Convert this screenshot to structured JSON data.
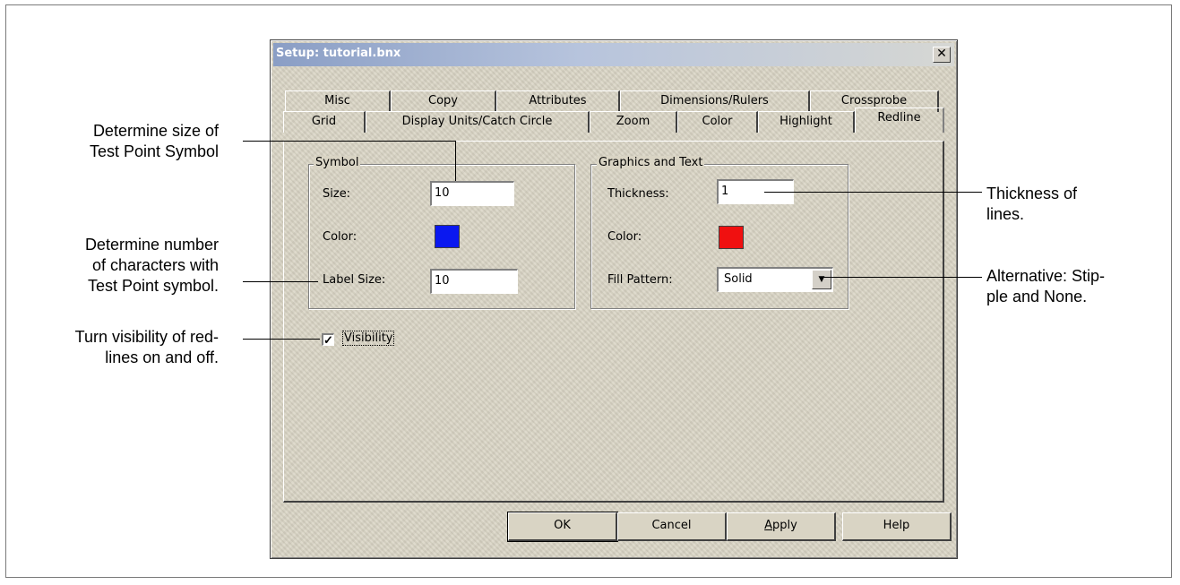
{
  "dialog": {
    "title": "Setup: tutorial.bnx",
    "close_glyph": "✕"
  },
  "tabs": {
    "row_back": [
      "Misc",
      "Copy",
      "Attributes",
      "Dimensions/Rulers",
      "Crossprobe"
    ],
    "row_front": [
      "Grid",
      "Display Units/Catch Circle",
      "Zoom",
      "Color",
      "Highlight",
      "Redline"
    ],
    "active": "Redline"
  },
  "symbol_group": {
    "title": "Symbol",
    "size_label": "Size:",
    "size_value": "10",
    "color_label": "Color:",
    "color_hex": "#0a18f0",
    "label_size_label": "Label Size:",
    "label_size_value": "10"
  },
  "graphics_group": {
    "title": "Graphics and Text",
    "thickness_label": "Thickness:",
    "thickness_value": "1",
    "color_label": "Color:",
    "color_hex": "#f01010",
    "fill_pattern_label": "Fill Pattern:",
    "fill_pattern_value": "Solid"
  },
  "visibility": {
    "label": "Visibility",
    "checked": true,
    "check_glyph": "✓"
  },
  "buttons": {
    "ok": "OK",
    "cancel": "Cancel",
    "apply_accel": "A",
    "apply_rest": "pply",
    "help": "Help"
  },
  "callouts": {
    "symbol_size": [
      "Determine size of",
      "Test Point Symbol"
    ],
    "label_chars": [
      "Determine number",
      "of characters with",
      "Test Point symbol."
    ],
    "visibility": [
      "Turn visibility of red-",
      "lines on and off."
    ],
    "thickness": [
      "Thickness of",
      "lines."
    ],
    "fill_alt": [
      "Alternative:  Stip-",
      "ple and None."
    ]
  },
  "icons": {
    "dropdown_arrow": "▼"
  }
}
